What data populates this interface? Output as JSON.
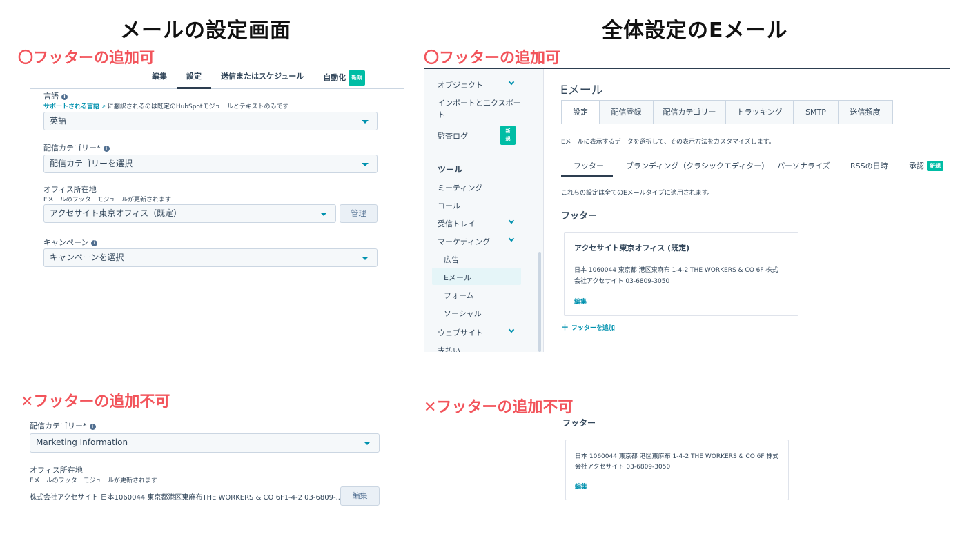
{
  "titles": {
    "left": "メールの設定画面",
    "right": "全体設定のEメール"
  },
  "notes": {
    "ok": "〇フッターの追加可",
    "ng": "✕フッターの追加不可"
  },
  "email_settings": {
    "tabs": [
      "編集",
      "設定",
      "送信またはスケジュール",
      "自動化"
    ],
    "badge_new": "新規",
    "language_label": "言語",
    "language_help_link": "サポートされる言語",
    "language_help_text": "に翻訳されるのは既定のHubSpotモジュールとテキストのみです",
    "language_value": "英語",
    "category_label": "配信カテゴリー",
    "required_mark": "*",
    "category_value": "配信カテゴリーを選択",
    "office_label": "オフィス所在地",
    "office_help": "Eメールのフッターモジュールが更新されます",
    "office_value": "アクセサイト東京オフィス（既定）",
    "manage_button": "管理",
    "campaign_label": "キャンペーン",
    "campaign_value": "キャンペーンを選択"
  },
  "email_settings_ng": {
    "category_label": "配信カテゴリー",
    "required_mark": "*",
    "category_value": "Marketing Information",
    "office_label": "オフィス所在地",
    "office_help": "Eメールのフッターモジュールが更新されます",
    "office_text": "株式会社アクセサイト 日本1060044 東京都港区東麻布THE WORKERS & CO 6F1-4-2 03-6809-...",
    "edit_button": "編集"
  },
  "sidebar": {
    "items": {
      "objects": "オブジェクト",
      "import_export_1": "インポートとエクスポー",
      "import_export_2": "ト",
      "audit_log": "監査ログ",
      "audit_badge": "新規",
      "tools_heading": "ツール",
      "meetings": "ミーティング",
      "calls": "コール",
      "inbox": "受信トレイ",
      "marketing": "マーケティング",
      "ads": "広告",
      "email": "Eメール",
      "forms": "フォーム",
      "social": "ソーシャル",
      "website": "ウェブサイト",
      "payments": "支払い"
    }
  },
  "global_email": {
    "heading": "Eメール",
    "tabs": [
      "設定",
      "配信登録",
      "配信カテゴリー",
      "トラッキング",
      "SMTP",
      "送信頻度"
    ],
    "description": "Eメールに表示するデータを選択して、その表示方法をカスタマイズします。",
    "subtabs": [
      "フッター",
      "ブランディング（クラシックエディター）",
      "パーソナライズ",
      "RSSの日時",
      "承認"
    ],
    "subtab_badge": "新規",
    "applies_note": "これらの設定は全てのEメールタイプに適用されます。",
    "footer_heading": "フッター",
    "card_title": "アクセサイト東京オフィス (既定)",
    "card_address_1": "日本 1060044 東京都 港区東麻布 1-4-2 THE WORKERS & CO 6F 株式",
    "card_address_2": "会社アクセサイト 03-6809-3050",
    "card_edit": "編集",
    "add_footer": "フッターを追加"
  },
  "global_email_ng": {
    "footer_heading": "フッター",
    "card_address_1": "日本 1060044 東京都 港区東麻布 1-4-2 THE WORKERS & CO 6F 株式",
    "card_address_2": "会社アクセサイト 03-6809-3050",
    "card_edit": "編集"
  },
  "colors": {
    "note_red": "#f2545b",
    "link_teal": "#0091ae",
    "badge_green": "#00bda5",
    "text_dark": "#33475b"
  }
}
